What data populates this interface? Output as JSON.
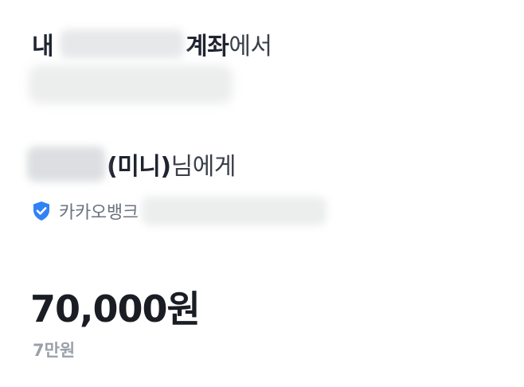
{
  "transfer": {
    "from_prefix": "내",
    "from_account_word": "계좌",
    "from_suffix": "에서",
    "to_name_paren": "(미니)",
    "to_suffix": "님에게",
    "bank_name": "카카오뱅크",
    "amount": "70,000원",
    "amount_korean": "7만원"
  },
  "colors": {
    "verified_badge": "#3182f6",
    "primary_text": "#1f2430",
    "secondary_text": "#6b7280",
    "muted_text": "#9aa0a8"
  },
  "icons": {
    "verified": "shield-check-icon"
  }
}
